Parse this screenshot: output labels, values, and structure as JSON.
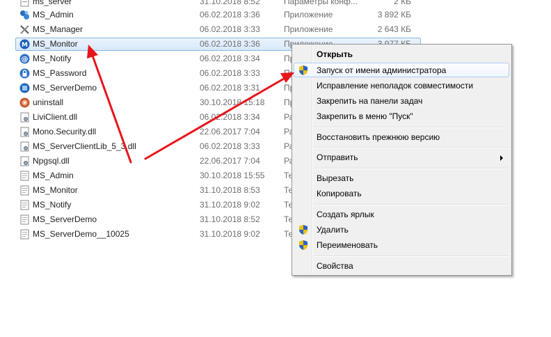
{
  "files": [
    {
      "name": "ms_server",
      "date": "31.10.2018 8:52",
      "type": "Параметры конф...",
      "size": "2 КБ",
      "icon": "config-file-icon"
    },
    {
      "name": "MS_Admin",
      "date": "06.02.2018 3:36",
      "type": "Приложение",
      "size": "3 892 КБ",
      "icon": "admin-app-icon"
    },
    {
      "name": "MS_Manager",
      "date": "06.02.2018 3:33",
      "type": "Приложение",
      "size": "2 643 КБ",
      "icon": "tools-app-icon"
    },
    {
      "name": "MS_Monitor",
      "date": "06.02.2018 3:36",
      "type": "Приложение",
      "size": "3 977 КБ",
      "icon": "monitor-app-icon"
    },
    {
      "name": "MS_Notify",
      "date": "06.02.2018 3:34",
      "type": "Пр",
      "size": "",
      "icon": "at-sign-app-icon"
    },
    {
      "name": "MS_Password",
      "date": "06.02.2018 3:33",
      "type": "Пр",
      "size": "",
      "icon": "lock-app-icon"
    },
    {
      "name": "MS_ServerDemo",
      "date": "06.02.2018 3:31",
      "type": "Пр",
      "size": "",
      "icon": "server-app-icon"
    },
    {
      "name": "uninstall",
      "date": "30.10.2018 15:18",
      "type": "Пр",
      "size": "",
      "icon": "uninstall-icon"
    },
    {
      "name": "LiviClient.dll",
      "date": "06.02.2018 3:34",
      "type": "Ра",
      "size": "",
      "icon": "dll-file-icon"
    },
    {
      "name": "Mono.Security.dll",
      "date": "22.06.2017 7:04",
      "type": "Ра",
      "size": "",
      "icon": "dll-file-icon"
    },
    {
      "name": "MS_ServerClientLib_5_3.dll",
      "date": "06.02.2018 3:33",
      "type": "Ра",
      "size": "",
      "icon": "dll-file-icon"
    },
    {
      "name": "Npgsql.dll",
      "date": "22.06.2017 7:04",
      "type": "Ра",
      "size": "",
      "icon": "dll-file-icon"
    },
    {
      "name": "MS_Admin",
      "date": "30.10.2018 15:55",
      "type": "Те",
      "size": "",
      "icon": "text-file-icon"
    },
    {
      "name": "MS_Monitor",
      "date": "31.10.2018 8:53",
      "type": "Те",
      "size": "",
      "icon": "text-file-icon"
    },
    {
      "name": "MS_Notify",
      "date": "31.10.2018 9:02",
      "type": "Те",
      "size": "",
      "icon": "text-file-icon"
    },
    {
      "name": "MS_ServerDemo",
      "date": "31.10.2018 8:52",
      "type": "Те",
      "size": "",
      "icon": "text-file-icon"
    },
    {
      "name": "MS_ServerDemo__10025",
      "date": "31.10.2018 9:02",
      "type": "Те",
      "size": "",
      "icon": "text-file-icon"
    }
  ],
  "context_menu": {
    "open": "Открыть",
    "run_as_admin": "Запуск от имени администратора",
    "troubleshoot": "Исправление неполадок совместимости",
    "pin_taskbar": "Закрепить на панели задач",
    "pin_start": "Закрепить в меню \"Пуск\"",
    "restore": "Восстановить прежнюю версию",
    "send_to": "Отправить",
    "cut": "Вырезать",
    "copy": "Копировать",
    "create_shortcut": "Создать ярлык",
    "delete": "Удалить",
    "rename": "Переименовать",
    "properties": "Свойства"
  },
  "colors": {
    "selection": "#d9e9fb",
    "annotation_arrow": "#e8141b",
    "shield_blue": "#2a62c7",
    "shield_yellow": "#f2c200"
  }
}
